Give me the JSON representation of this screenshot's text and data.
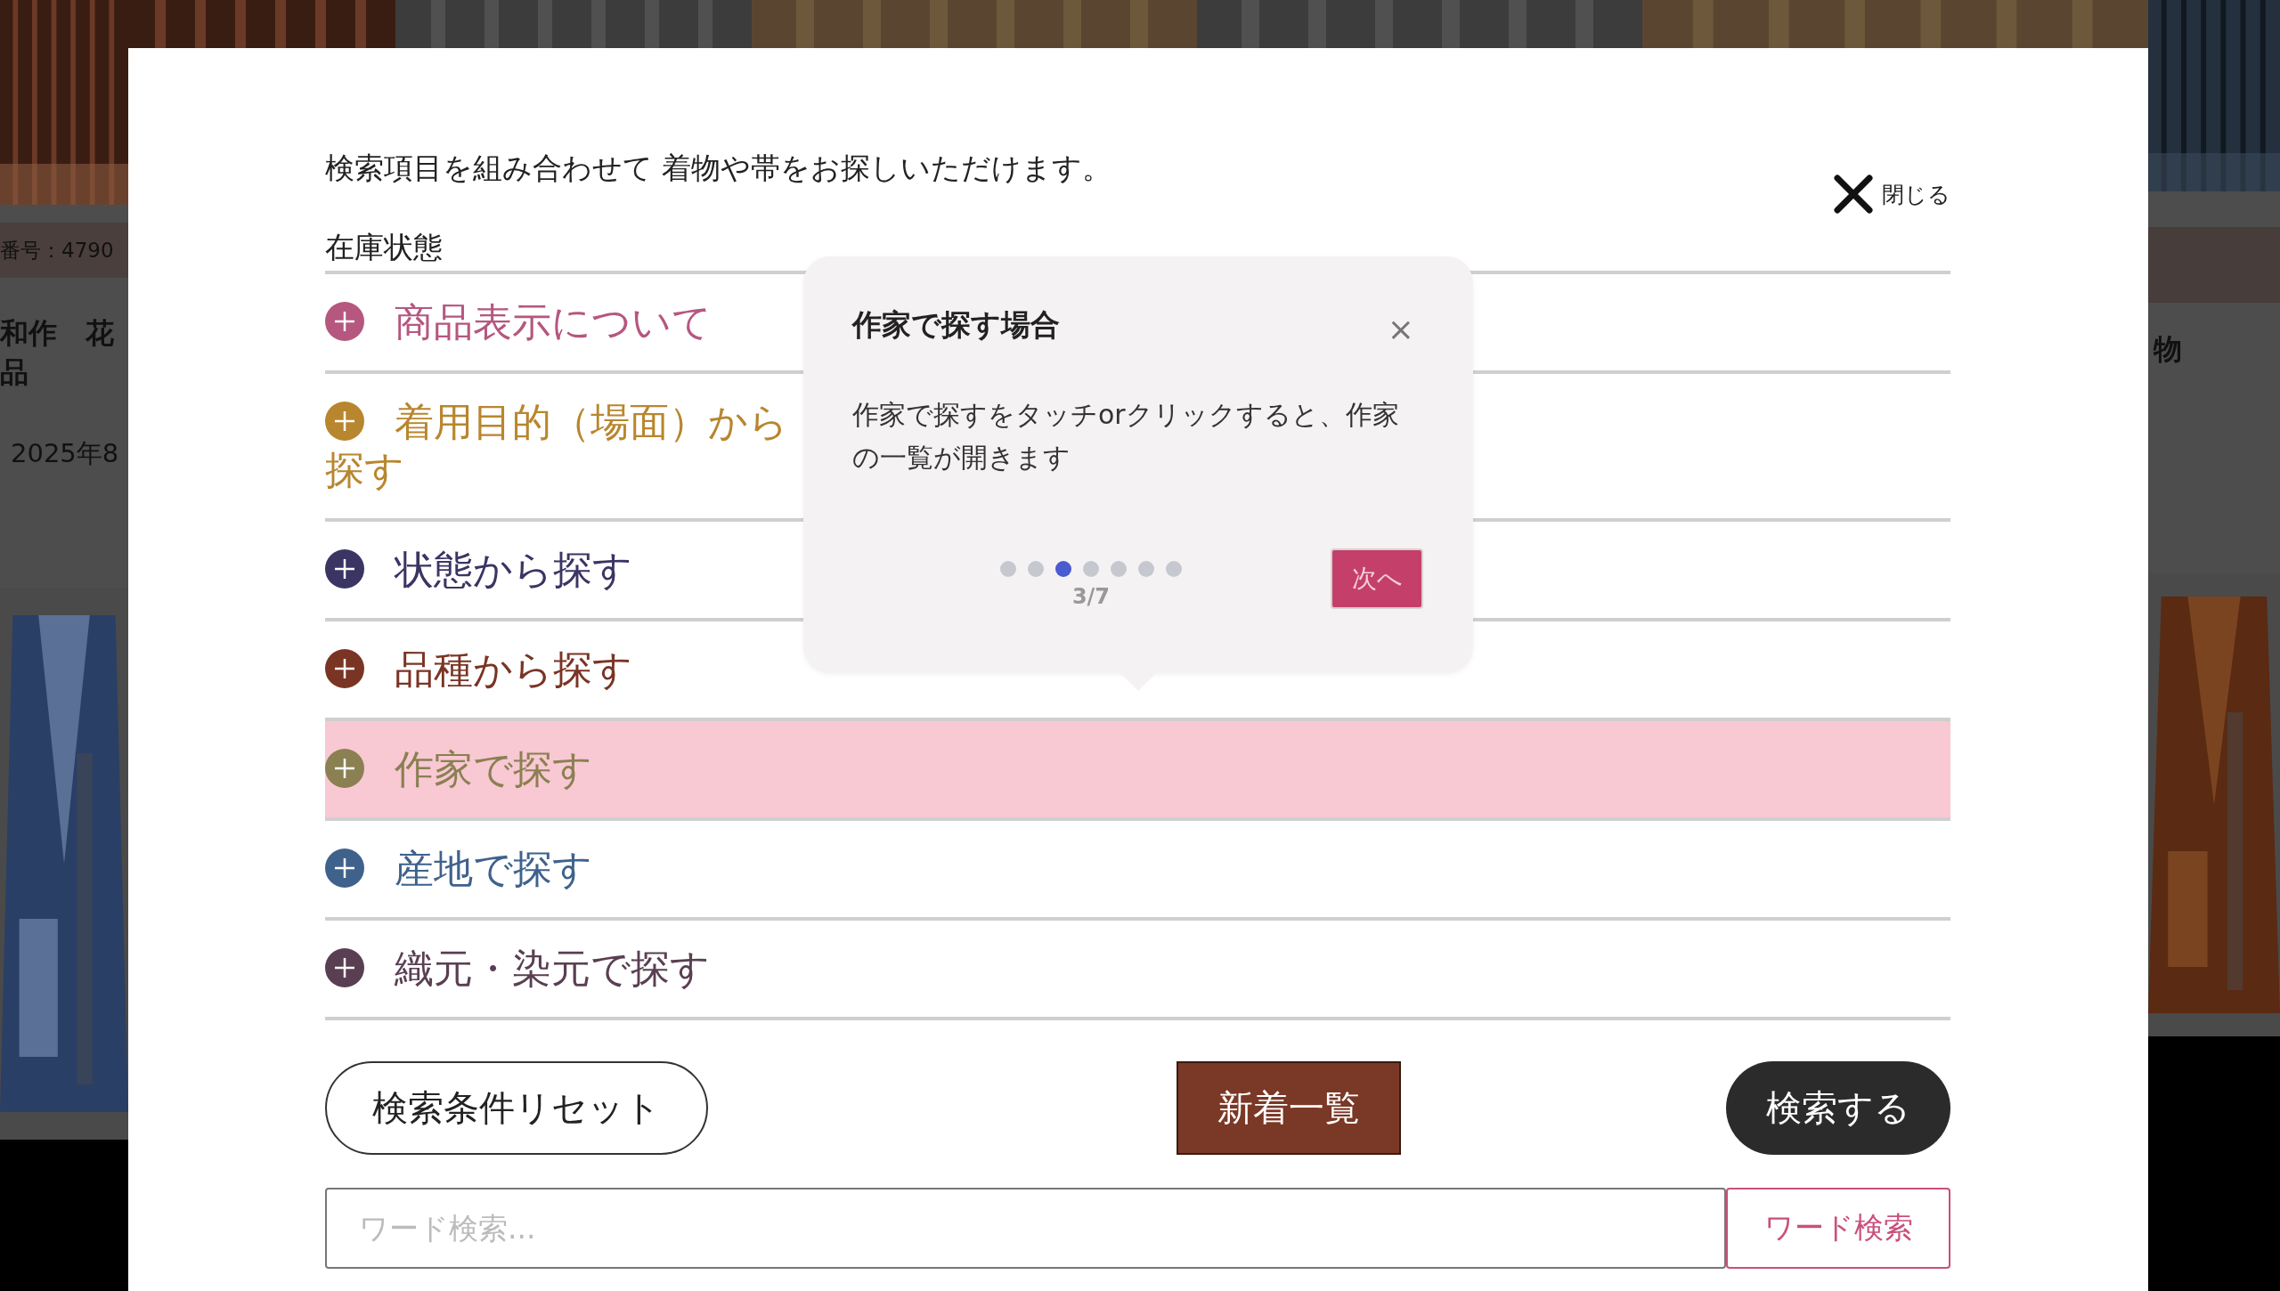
{
  "background_page": {
    "left_column": {
      "item_number": "番号：4790",
      "title_lines": [
        "和作　花",
        "品"
      ],
      "date": "2025年8"
    },
    "right_column": {
      "title": "物"
    }
  },
  "modal": {
    "intro": "検索項目を組み合わせて 着物や帯をお探しいただけます。",
    "close_label": "閉じる",
    "section_label": "在庫状態",
    "accordion": [
      {
        "label": "商品表示について",
        "color": "#b5577f",
        "selected": false
      },
      {
        "label": "着用目的（場面）から探す",
        "color": "#b8862e",
        "selected": false
      },
      {
        "label": "状態から探す",
        "color": "#3a3563",
        "selected": false
      },
      {
        "label": "品種から探す",
        "color": "#7a3424",
        "selected": false
      },
      {
        "label": "作家で探す",
        "color": "#8a8052",
        "selected": true
      },
      {
        "label": "産地で探す",
        "color": "#3f628c",
        "selected": false
      },
      {
        "label": "織元・染元で探す",
        "color": "#5a3f52",
        "selected": false
      }
    ],
    "buttons": {
      "reset": "検索条件リセット",
      "new_arrivals": "新着一覧",
      "search": "検索する"
    },
    "word_search": {
      "placeholder": "ワード検索...",
      "button": "ワード検索"
    }
  },
  "tooltip": {
    "title": "作家で探す場合",
    "close": "×",
    "body": "作家で探すをタッチorクリックすると、作家の一覧が開きます",
    "steps": [
      {
        "selected": false
      },
      {
        "selected": false
      },
      {
        "selected": true
      },
      {
        "selected": false
      },
      {
        "selected": false
      },
      {
        "selected": false
      },
      {
        "selected": false
      }
    ],
    "counter": "3/7",
    "next": {
      "label": "次へ",
      "disabled": true
    }
  }
}
